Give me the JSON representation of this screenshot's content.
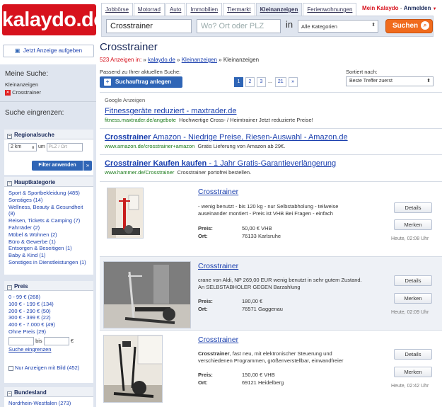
{
  "brand": {
    "logo": "kalaydo.de",
    "color": "#d7121d"
  },
  "nav": {
    "tabs": [
      "Jobbörse",
      "Motorrad",
      "Auto",
      "Immobilien",
      "Tiermarkt",
      "Kleinanzeigen",
      "Ferienwohnungen"
    ],
    "active": "Kleinanzeigen"
  },
  "user": {
    "account": "Mein Kalaydo",
    "separator": "-",
    "login": "Anmelden"
  },
  "search": {
    "query": "Crosstrainer",
    "location_placeholder": "Wo? Ort oder PLZ",
    "in_label": "in",
    "category": "Alle Kategorien",
    "button": "Suchen"
  },
  "sidebar": {
    "post_ad": "Jetzt Anzeige aufgeben",
    "my_search_title": "Meine Suche:",
    "my_search_category": "Kleinanzeigen",
    "my_search_term": "Crosstrainer",
    "refine_title": "Suche eingrenzen:",
    "regional": {
      "title": "Regionalsuche",
      "radius": "2 km",
      "um": "um",
      "plz_placeholder": "PLZ / Ort",
      "filter_button": "Filter anwenden"
    },
    "categories": {
      "title": "Hauptkategorie",
      "items": [
        "Sport & Sportbekleidung (485)",
        "Sonstiges (14)",
        "Wellness, Beauty & Gesundheit (8)",
        "Reisen, Tickets & Camping (7)",
        "Fahrräder (2)",
        "Möbel & Wohnen (2)",
        "Büro & Gewerbe (1)",
        "Entsorgen & Beseitigen (1)",
        "Baby & Kind (1)",
        "Sonstiges in Dienstleistungen (1)"
      ]
    },
    "price": {
      "title": "Preis",
      "items": [
        "0 - 99 € (268)",
        "100 € - 199 € (134)",
        "200 € - 290 € (50)",
        "300 € - 399 € (22)",
        "400 € - 7.000 € (49)",
        "Ohne Preis (29)"
      ],
      "bis": "bis",
      "currency": "€",
      "refine_link": "Suche eingrenzen"
    },
    "only_with_image": "Nur Anzeigen mit Bild (452)",
    "state": {
      "title": "Bundesland",
      "items": [
        "Nordrhein-Westfalen (273)"
      ]
    }
  },
  "main": {
    "title": "Crosstrainer",
    "count": "523 Anzeigen in:",
    "breadcrumb": [
      "kalaydo.de",
      "Kleinanzeigen",
      "Kleinanzeigen"
    ],
    "matching": "Passend zu Ihrer aktuellen Suche:",
    "save_search": "Suchauftrag anlegen",
    "pages": [
      "1",
      "2",
      "3",
      "...",
      "21",
      "»"
    ],
    "sort_label": "Sortiert nach:",
    "sort_value": "Beste Treffer zuerst"
  },
  "google": {
    "title": "Google Anzeigen",
    "ads": [
      {
        "title_pre": "Fitnessgeräte reduziert - maxtrader.de",
        "title_bold": "",
        "title_post": "",
        "url": "fitness.maxtrader.de/angebote",
        "text": "Hochwertige Cross- / Heimtrainer Jetzt reduzierte Preise!"
      },
      {
        "title_pre": "",
        "title_bold": "Crosstrainer",
        "title_post": " Amazon - Niedrige Preise, Riesen-Auswahl - Amazon.de",
        "url": "www.amazon.de/crosstrainer+amazon",
        "text": "Gratis Lieferung von Amazon ab 29€."
      },
      {
        "title_pre": "",
        "title_bold": "Crosstrainer Kaufen kaufen",
        "title_post": " - 1 Jahr Gratis-Garantieverlängerung",
        "url": "www.hammer.de/Crosstrainer",
        "text": "Crosstrainer portofrei bestellen."
      }
    ]
  },
  "listings": [
    {
      "title": "Crosstrainer",
      "description": "- wenig benutzt - bis 120 kg - nur Selbstabholung - teilweise auseinander montiert - Preis ist VHB Bei Fragen - einfach",
      "price_label": "Preis:",
      "price": "50,00 € VHB",
      "place_label": "Ort:",
      "place": "76133 Karlsruhe",
      "details": "Details",
      "remember": "Merken",
      "time": "Heute, 02:08 Uhr"
    },
    {
      "title": "Crosstrainer",
      "description": "crane von Aldi, NP 269,00 EUR wenig benutzt in sehr gutem Zustand. An SELBSTABHOLER GEGEN Barzahlung",
      "price_label": "Preis:",
      "price": "180,00 €",
      "place_label": "Ort:",
      "place": "76571 Gaggenau",
      "details": "Details",
      "remember": "Merken",
      "time": "Heute, 02:09 Uhr"
    },
    {
      "title": "Crosstrainer",
      "description": "Crosstrainer, fast neu, mit elektronischer Steuerung und verschiedenen Programmen, größenverstellbar, einwandfreier",
      "price_label": "Preis:",
      "price": "150,00 € VHB",
      "place_label": "Ort:",
      "place": "69121 Heidelberg",
      "details": "Details",
      "remember": "Merken",
      "time": "Heute, 02:42 Uhr"
    }
  ]
}
